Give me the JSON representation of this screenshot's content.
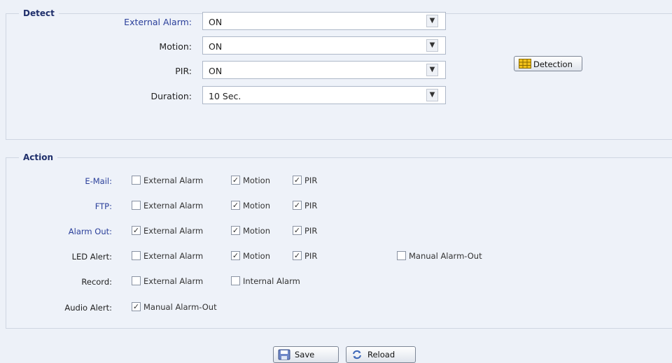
{
  "detect": {
    "legend": "Detect",
    "rows": [
      {
        "label": "External Alarm:",
        "value": "ON"
      },
      {
        "label": "Motion:",
        "value": "ON"
      },
      {
        "label": "PIR:",
        "value": "ON"
      },
      {
        "label": "Duration:",
        "value": "10 Sec."
      }
    ],
    "detection_button": "Detection"
  },
  "action": {
    "legend": "Action",
    "rows": [
      {
        "label": "E-Mail:",
        "options": [
          {
            "label": "External Alarm",
            "checked": false
          },
          {
            "label": "Motion",
            "checked": true
          },
          {
            "label": "PIR",
            "checked": true
          }
        ]
      },
      {
        "label": "FTP:",
        "options": [
          {
            "label": "External Alarm",
            "checked": false
          },
          {
            "label": "Motion",
            "checked": true
          },
          {
            "label": "PIR",
            "checked": true
          }
        ]
      },
      {
        "label": "Alarm Out:",
        "options": [
          {
            "label": "External Alarm",
            "checked": true
          },
          {
            "label": "Motion",
            "checked": true
          },
          {
            "label": "PIR",
            "checked": true
          }
        ]
      },
      {
        "label": "LED Alert:",
        "options": [
          {
            "label": "External Alarm",
            "checked": false
          },
          {
            "label": "Motion",
            "checked": true
          },
          {
            "label": "PIR",
            "checked": true
          },
          {
            "label": "Manual Alarm-Out",
            "checked": false
          }
        ]
      },
      {
        "label": "Record:",
        "options": [
          {
            "label": "External Alarm",
            "checked": false
          },
          {
            "label": "Internal Alarm",
            "checked": false
          }
        ]
      },
      {
        "label": "Audio Alert:",
        "options": [
          {
            "label": "Manual Alarm-Out",
            "checked": true
          }
        ]
      }
    ]
  },
  "footer": {
    "save_label": "Save",
    "reload_label": "Reload"
  },
  "icons": {
    "dropdown": "chevron-down-icon",
    "detection": "grid-icon",
    "save": "floppy-disk-icon",
    "reload": "refresh-icon"
  }
}
